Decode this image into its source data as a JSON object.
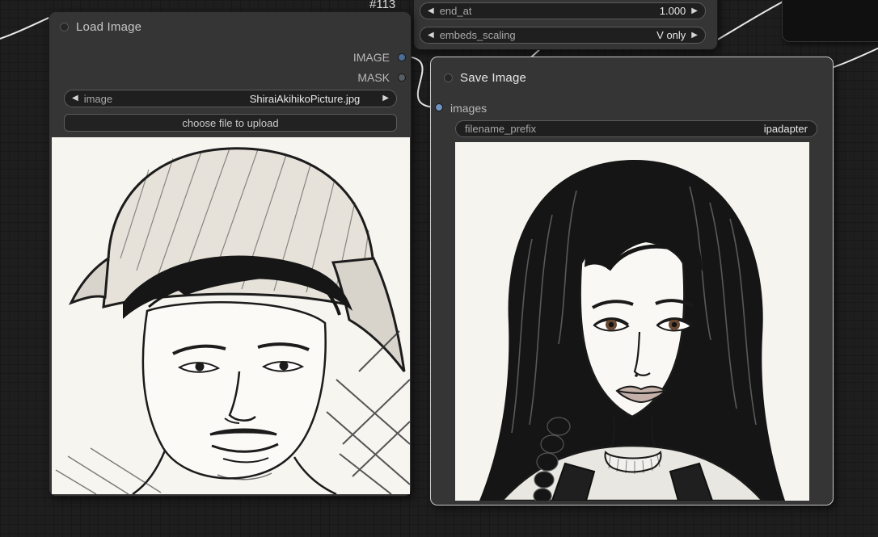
{
  "canvas": {
    "background": "#1e1e1e",
    "grid_line": "#181818"
  },
  "icons": {
    "arrow_left": "◀",
    "arrow_right": "▶"
  },
  "colors": {
    "node_body": "#353535",
    "widget_bg": "#1f1f1f",
    "widget_border": "#5c5c5c",
    "selected_node_border": "#c9c9c9",
    "wire": "#e9e9e9",
    "image_output_slot": "#4a6e96",
    "mask_output_slot": "#565d63",
    "images_input_slot": "#6f93c0"
  },
  "nodes": {
    "load_image": {
      "title": "Load Image",
      "outputs": [
        {
          "label": "IMAGE"
        },
        {
          "label": "MASK"
        }
      ],
      "widgets": {
        "image": {
          "name": "image",
          "value": "ShiraiAkihikoPicture.jpg"
        },
        "upload_label": "choose file to upload"
      },
      "preview_description": "Black-and-white ink sketch portrait of a man wearing a wide-brim hat"
    },
    "ipadapter": {
      "badge": "#113",
      "widgets": [
        {
          "name": "end_at",
          "value": "1.000"
        },
        {
          "name": "embeds_scaling",
          "value": "V only"
        }
      ]
    },
    "save_image": {
      "title": "Save Image",
      "inputs": [
        {
          "label": "images"
        }
      ],
      "widgets": {
        "filename_prefix": {
          "name": "filename_prefix",
          "value": "ipadapter"
        }
      },
      "preview_description": "Black-and-white ink sketch portrait of a young woman with long dark hair"
    }
  }
}
